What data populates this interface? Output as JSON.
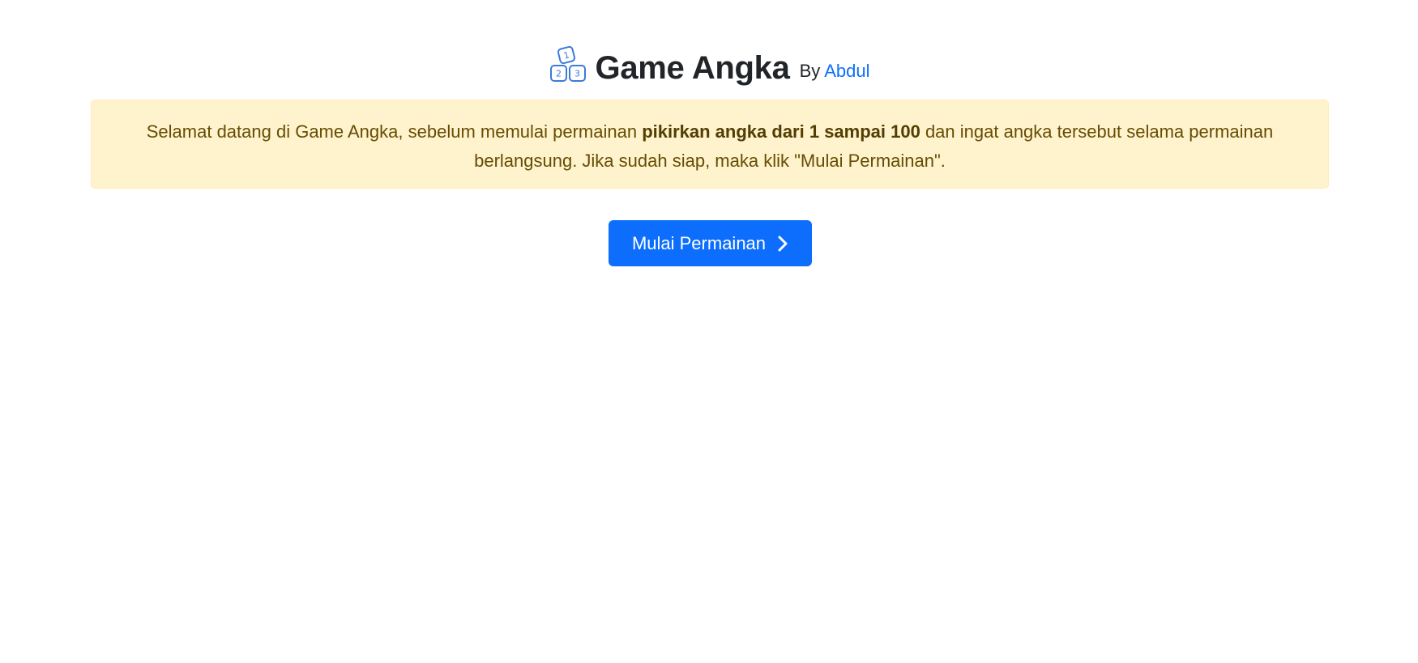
{
  "header": {
    "title": "Game Angka",
    "by_label": "By",
    "author": "Abdul",
    "logo_icon": "number-blocks-123-icon",
    "logo_digits": [
      "1",
      "2",
      "3"
    ]
  },
  "alert": {
    "text_before": "Selamat datang di Game Angka, sebelum memulai permainan ",
    "text_bold": "pikirkan angka dari 1 sampai 100",
    "text_after": " dan ingat angka tersebut selama permainan berlangsung. Jika sudah siap, maka klik \"Mulai Permainan\"."
  },
  "actions": {
    "start_label": "Mulai Permainan",
    "start_icon": "chevron-right-icon"
  },
  "colors": {
    "primary": "#0d6efd",
    "alert_bg": "#fff3cd",
    "alert_text": "#664d03"
  }
}
